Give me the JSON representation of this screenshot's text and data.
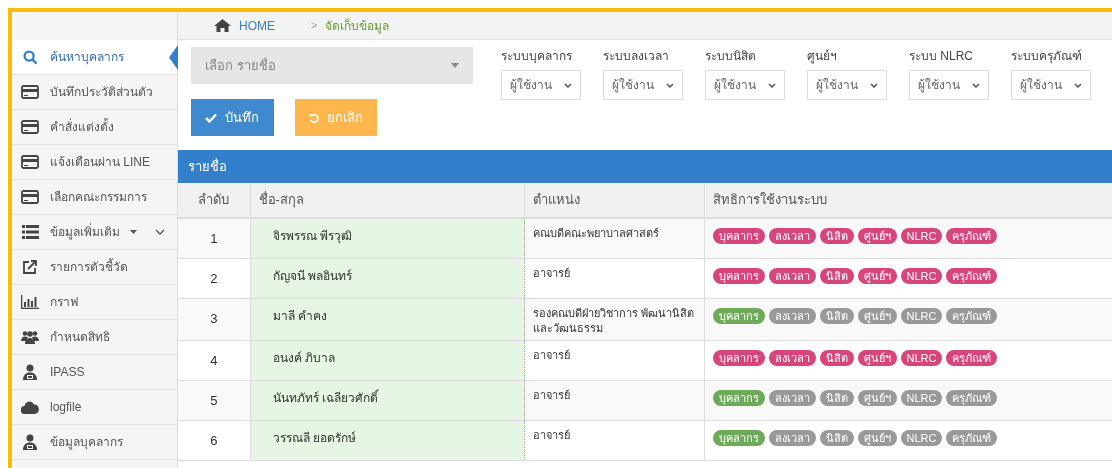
{
  "breadcrumb": {
    "home": "HOME",
    "separator": ">",
    "current": "จัดเก็บข้อมูล"
  },
  "sidebar": {
    "items": [
      {
        "label": "ค้นหาบุคลากร",
        "selected": true
      },
      {
        "label": "บันทึกประวัติส่วนตัว",
        "selected": false
      },
      {
        "label": "คำสั่งแต่งตั้ง",
        "selected": false
      },
      {
        "label": "แจ้งเตือนผ่าน LINE",
        "selected": false
      },
      {
        "label": "เลือกคณะกรรมการ",
        "selected": false
      },
      {
        "label": "ข้อมูลเพิ่มเติม",
        "selected": false,
        "expandable": true
      },
      {
        "label": "รายการตัวชี้วัด",
        "selected": false
      },
      {
        "label": "กราฟ",
        "selected": false
      },
      {
        "label": "กำหนดสิทธิ",
        "selected": false
      },
      {
        "label": "IPASS",
        "selected": false
      },
      {
        "label": "logfile",
        "selected": false
      },
      {
        "label": "ข้อมูลบุคลากร",
        "selected": false
      }
    ]
  },
  "name_select": {
    "placeholder": "เลือก รายชื่อ"
  },
  "system_filters": [
    {
      "label": "ระบบบุคลากร",
      "value": "ผู้ใช้งาน"
    },
    {
      "label": "ระบบลงเวลา",
      "value": "ผู้ใช้งาน"
    },
    {
      "label": "ระบบนิสิต",
      "value": "ผู้ใช้งาน"
    },
    {
      "label": "ศูนย์ฯ",
      "value": "ผู้ใช้งาน"
    },
    {
      "label": "ระบบ NLRC",
      "value": "ผู้ใช้งาน"
    },
    {
      "label": "ระบบครุภัณฑ์",
      "value": "ผู้ใช้งาน"
    }
  ],
  "buttons": [
    {
      "kind": "save",
      "label": "บันทึก"
    },
    {
      "kind": "cancel",
      "label": "ยกเลิก"
    }
  ],
  "table": {
    "title": "รายชื่อ",
    "columns": [
      "ลำดับ",
      "ชื่อ-สกุล",
      "ตำแหน่ง",
      "สิทธิการใช้งานระบบ"
    ],
    "rows": [
      {
        "no": "1",
        "name": "จิรพรรณ พีรวุฒิ",
        "position": "คณบดีคณะพยาบาลศาสตร์",
        "rights": [
          {
            "label": "บุคลากร",
            "color": "#d6457c"
          },
          {
            "label": "ลงเวลา",
            "color": "#d6457c"
          },
          {
            "label": "นิสิต",
            "color": "#d6457c"
          },
          {
            "label": "ศูนย์ฯ",
            "color": "#d6457c"
          },
          {
            "label": "NLRC",
            "color": "#d6457c"
          },
          {
            "label": "ครุภัณฑ์",
            "color": "#d6457c"
          }
        ]
      },
      {
        "no": "2",
        "name": "กัญจนี พลอินทร์",
        "position": "อาจารย์",
        "rights": [
          {
            "label": "บุคลากร",
            "color": "#d6457c"
          },
          {
            "label": "ลงเวลา",
            "color": "#d6457c"
          },
          {
            "label": "นิสิต",
            "color": "#d6457c"
          },
          {
            "label": "ศูนย์ฯ",
            "color": "#d6457c"
          },
          {
            "label": "NLRC",
            "color": "#d6457c"
          },
          {
            "label": "ครุภัณฑ์",
            "color": "#d6457c"
          }
        ]
      },
      {
        "no": "3",
        "name": "มาลี คำคง",
        "position": "รองคณบดีฝ่ายวิชาการ พัฒนานิสิต และวัฒนธรรม",
        "rights": [
          {
            "label": "บุคลากร",
            "color": "#6faa5a"
          },
          {
            "label": "ลงเวลา",
            "color": "#999999"
          },
          {
            "label": "นิสิต",
            "color": "#999999"
          },
          {
            "label": "ศูนย์ฯ",
            "color": "#999999"
          },
          {
            "label": "NLRC",
            "color": "#999999"
          },
          {
            "label": "ครุภัณฑ์",
            "color": "#999999"
          }
        ]
      },
      {
        "no": "4",
        "name": "อนงค์ ภิบาล",
        "position": "อาจารย์",
        "rights": [
          {
            "label": "บุคลากร",
            "color": "#d6457c"
          },
          {
            "label": "ลงเวลา",
            "color": "#d6457c"
          },
          {
            "label": "นิสิต",
            "color": "#d6457c"
          },
          {
            "label": "ศูนย์ฯ",
            "color": "#d6457c"
          },
          {
            "label": "NLRC",
            "color": "#d6457c"
          },
          {
            "label": "ครุภัณฑ์",
            "color": "#d6457c"
          }
        ]
      },
      {
        "no": "5",
        "name": "นันทภัทร์ เฉลียวศักดิ์",
        "position": "อาจารย์",
        "rights": [
          {
            "label": "บุคลากร",
            "color": "#6faa5a"
          },
          {
            "label": "ลงเวลา",
            "color": "#999999"
          },
          {
            "label": "นิสิต",
            "color": "#999999"
          },
          {
            "label": "ศูนย์ฯ",
            "color": "#999999"
          },
          {
            "label": "NLRC",
            "color": "#999999"
          },
          {
            "label": "ครุภัณฑ์",
            "color": "#999999"
          }
        ]
      },
      {
        "no": "6",
        "name": "วรรณลี ยอดรักษ์",
        "position": "อาจารย์",
        "rights": [
          {
            "label": "บุคลากร",
            "color": "#6faa5a"
          },
          {
            "label": "ลงเวลา",
            "color": "#999999"
          },
          {
            "label": "นิสิต",
            "color": "#999999"
          },
          {
            "label": "ศูนย์ฯ",
            "color": "#999999"
          },
          {
            "label": "NLRC",
            "color": "#999999"
          },
          {
            "label": "ครุภัณฑ์",
            "color": "#999999"
          }
        ]
      }
    ]
  }
}
